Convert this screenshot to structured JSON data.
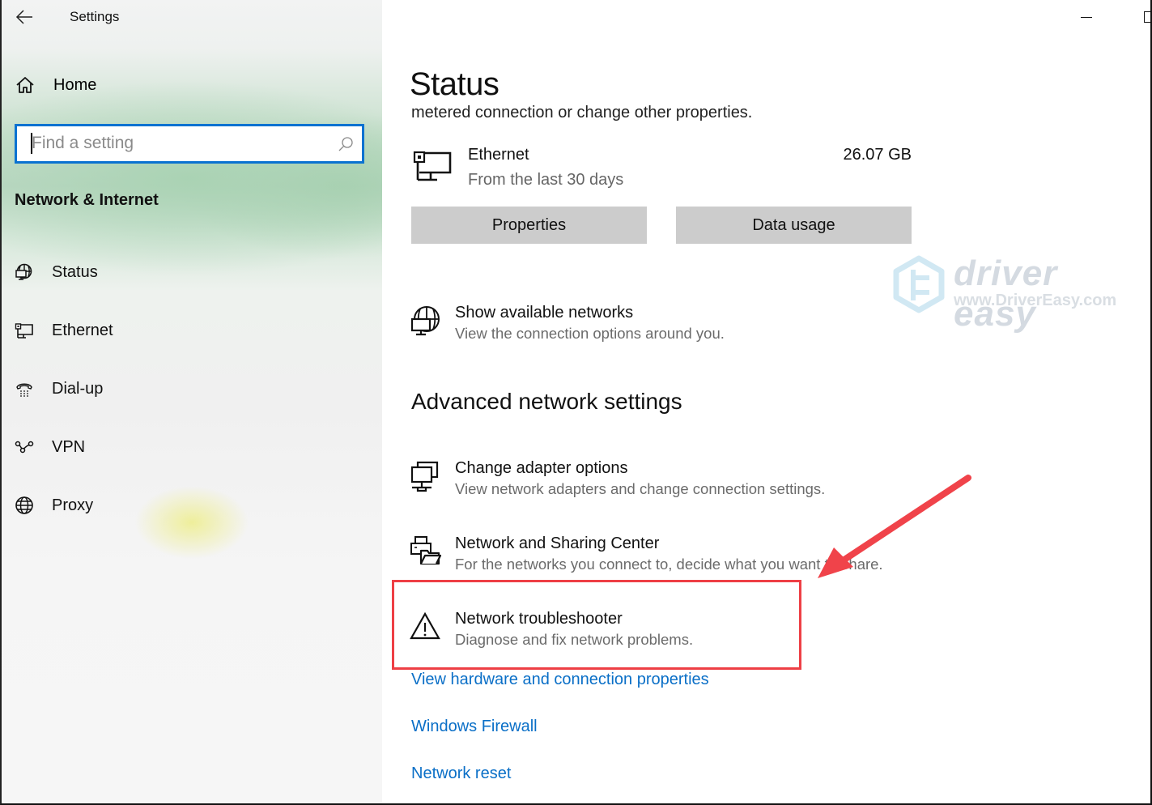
{
  "window": {
    "title": "Settings",
    "back_icon": "arrow-left-icon",
    "minimize_icon": "minimize-icon",
    "maximize_icon": "maximize-icon"
  },
  "sidebar": {
    "home_label": "Home",
    "home_icon": "home-icon",
    "search": {
      "placeholder": "Find a setting",
      "value": "",
      "icon": "search-icon"
    },
    "section_title": "Network & Internet",
    "items": [
      {
        "label": "Status",
        "icon": "globe-monitor-icon",
        "selected": true
      },
      {
        "label": "Ethernet",
        "icon": "ethernet-monitor-icon"
      },
      {
        "label": "Dial-up",
        "icon": "phone-icon"
      },
      {
        "label": "VPN",
        "icon": "vpn-icon"
      },
      {
        "label": "Proxy",
        "icon": "globe-icon"
      }
    ]
  },
  "main": {
    "page_title": "Status",
    "cut_off_text": "metered connection or change other properties.",
    "connection": {
      "name": "Ethernet",
      "subtitle": "From the last 30 days",
      "data_used": "26.07 GB",
      "icon": "ethernet-monitor-icon"
    },
    "buttons": {
      "properties": "Properties",
      "data_usage": "Data usage"
    },
    "show_networks": {
      "title": "Show available networks",
      "description": "View the connection options around you.",
      "icon": "globe-monitor-icon"
    },
    "advanced_title": "Advanced network settings",
    "advanced_items": [
      {
        "title": "Change adapter options",
        "description": "View network adapters and change connection settings.",
        "icon": "network-adapter-icon"
      },
      {
        "title": "Network and Sharing Center",
        "description": "For the networks you connect to, decide what you want to share.",
        "icon": "printer-folder-icon"
      },
      {
        "title": "Network troubleshooter",
        "description": "Diagnose and fix network problems.",
        "icon": "warning-icon",
        "highlighted": true
      }
    ],
    "links": [
      "View hardware and connection properties",
      "Windows Firewall",
      "Network reset"
    ]
  },
  "annotation": {
    "highlight_color": "#ee3f45",
    "arrow_color": "#f0434a"
  },
  "watermark": {
    "brand": "driver easy",
    "url": "www.DriverEasy.com"
  },
  "colors": {
    "accent": "#0a72d1",
    "link": "#0a6fc7",
    "button_bg": "#cccccc"
  }
}
